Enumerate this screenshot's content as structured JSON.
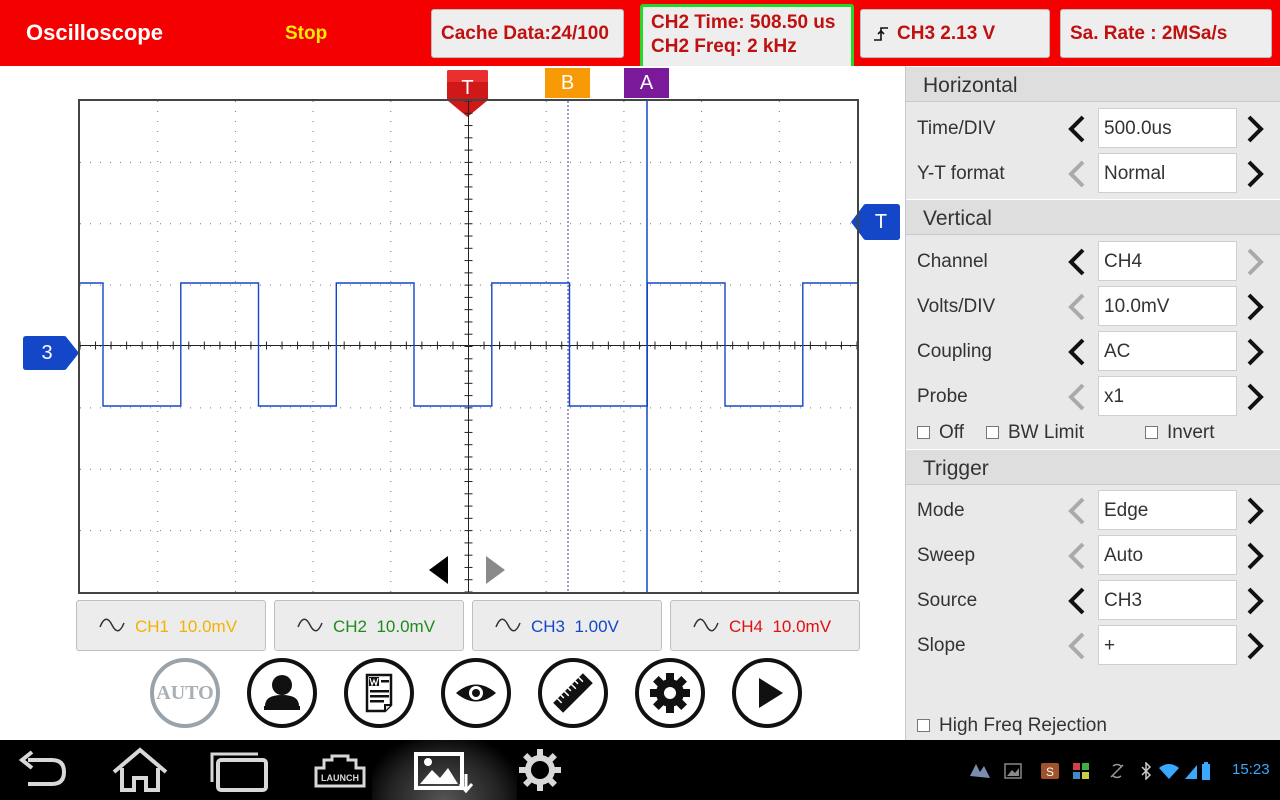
{
  "app": {
    "title": "Oscilloscope",
    "run_state": "Stop"
  },
  "status": {
    "cache_data": "Cache Data:24/100",
    "ch2_time": "CH2 Time: 508.50 us",
    "ch2_freq": "CH2 Freq: 2 kHz",
    "trigger_level": "CH3 2.13 V",
    "sample_rate": "Sa. Rate : 2MSa/s"
  },
  "markers": {
    "trigger_time": "T",
    "trigger_level": "T",
    "cursor_b": "B",
    "cursor_a": "A",
    "channel": "3"
  },
  "channels": [
    {
      "label": "CH1",
      "volts": "10.0mV",
      "color": "#f2b300"
    },
    {
      "label": "CH2",
      "volts": "10.0mV",
      "color": "#1f8a1f"
    },
    {
      "label": "CH3",
      "volts": "1.00V",
      "color": "#1446c8"
    },
    {
      "label": "CH4",
      "volts": "10.0mV",
      "color": "#e01010"
    }
  ],
  "toolbar": {
    "auto_label": "AUTO"
  },
  "panel": {
    "horizontal": {
      "title": "Horizontal",
      "rows": [
        {
          "label": "Time/DIV",
          "value": "500.0us",
          "left_enabled": true,
          "right_enabled": true
        },
        {
          "label": "Y-T format",
          "value": "Normal",
          "left_enabled": false,
          "right_enabled": true
        }
      ]
    },
    "vertical": {
      "title": "Vertical",
      "rows": [
        {
          "label": "Channel",
          "value": "CH4",
          "left_enabled": true,
          "right_enabled": false
        },
        {
          "label": "Volts/DIV",
          "value": "10.0mV",
          "left_enabled": false,
          "right_enabled": true
        },
        {
          "label": "Coupling",
          "value": "AC",
          "left_enabled": true,
          "right_enabled": true
        },
        {
          "label": "Probe",
          "value": "x1",
          "left_enabled": false,
          "right_enabled": true
        }
      ],
      "checks": [
        {
          "label": "Off",
          "checked": false
        },
        {
          "label": "BW Limit",
          "checked": false
        },
        {
          "label": "Invert",
          "checked": false
        }
      ]
    },
    "trigger": {
      "title": "Trigger",
      "rows": [
        {
          "label": "Mode",
          "value": "Edge",
          "left_enabled": false,
          "right_enabled": true
        },
        {
          "label": "Sweep",
          "value": "Auto",
          "left_enabled": false,
          "right_enabled": true
        },
        {
          "label": "Source",
          "value": "CH3",
          "left_enabled": true,
          "right_enabled": true
        },
        {
          "label": "Slope",
          "value": "+",
          "left_enabled": false,
          "right_enabled": true
        }
      ],
      "high_freq_rejection": {
        "label": "High Freq Rejection",
        "checked": false
      }
    }
  },
  "system_bar": {
    "clock": "15:23",
    "launch_label": "LAUNCH",
    "accent": "#3aa8ff"
  }
}
